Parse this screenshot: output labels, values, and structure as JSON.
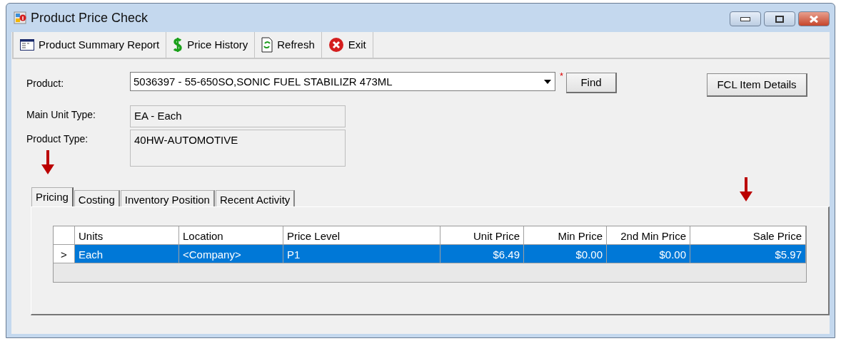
{
  "window": {
    "title": "Product Price Check"
  },
  "toolbar": [
    {
      "kind": "report",
      "label": "Product Summary Report"
    },
    {
      "kind": "dollar",
      "label": "Price History"
    },
    {
      "kind": "refresh",
      "label": "Refresh"
    },
    {
      "kind": "exit",
      "label": "Exit"
    }
  ],
  "product": {
    "label": "Product:",
    "value": "5036397 - 55-650SO,SONIC FUEL STABILIZR 473ML",
    "required_mark": "*",
    "find_button": "Find"
  },
  "fcl_button": "FCL Item Details",
  "fields": [
    {
      "label": "Main Unit Type:",
      "value": "EA - Each",
      "kind": "short"
    },
    {
      "label": "Product Type:",
      "value": "40HW-AUTOMOTIVE",
      "kind": "tall"
    }
  ],
  "tabs": [
    {
      "label": "Pricing",
      "selected": true
    },
    {
      "label": "Costing",
      "selected": false
    },
    {
      "label": "Inventory Position",
      "selected": false
    },
    {
      "label": "Recent Activity",
      "selected": false
    }
  ],
  "table": {
    "columns": [
      {
        "label": "Units",
        "kind": "text"
      },
      {
        "label": "Location",
        "kind": "text"
      },
      {
        "label": "Price Level",
        "kind": "text"
      },
      {
        "label": "Unit Price",
        "kind": "money"
      },
      {
        "label": "Min Price",
        "kind": "money"
      },
      {
        "label": "2nd Min Price",
        "kind": "money"
      },
      {
        "label": "Sale Price",
        "kind": "money"
      }
    ],
    "rows": [
      {
        "marker": ">",
        "selected": true,
        "cells": [
          "Each",
          "<Company>",
          "P1",
          "$6.49",
          "$0.00",
          "$0.00",
          "$5.97"
        ]
      }
    ]
  }
}
